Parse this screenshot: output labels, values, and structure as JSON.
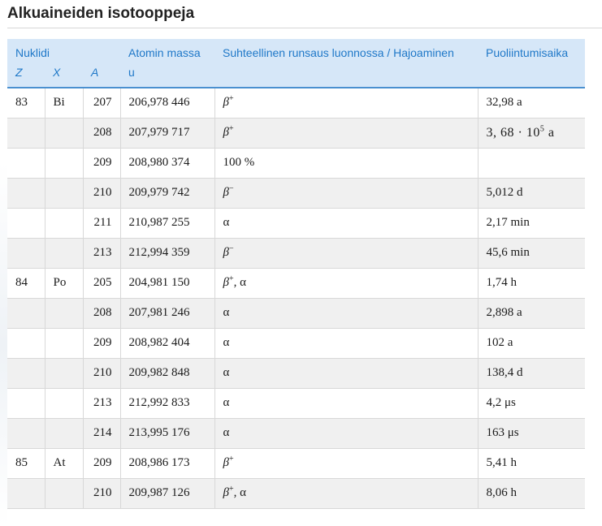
{
  "page": {
    "title": "Alkuaineiden isotooppeja"
  },
  "header": {
    "nuklidi": "Nuklidi",
    "z": "Z",
    "x": "X",
    "a": "A",
    "mass": "Atomin massa",
    "mass_unit": "u",
    "decay": "Suhteellinen runsaus luonnossa / Hajoaminen",
    "halflife": "Puoliintumisaika"
  },
  "rows": [
    {
      "z": "83",
      "x": "Bi",
      "a": "207",
      "mass": "206,978 446",
      "decay": "β+",
      "halflife": "32,98 a"
    },
    {
      "z": "",
      "x": "",
      "a": "208",
      "mass": "207,979 717",
      "decay": "β+",
      "halflife": "3, 68 · 105 a"
    },
    {
      "z": "",
      "x": "",
      "a": "209",
      "mass": "208,980 374",
      "decay": "100 %",
      "halflife": ""
    },
    {
      "z": "",
      "x": "",
      "a": "210",
      "mass": "209,979 742",
      "decay": "β−",
      "halflife": "5,012 d"
    },
    {
      "z": "",
      "x": "",
      "a": "211",
      "mass": "210,987 255",
      "decay": "α",
      "halflife": "2,17 min"
    },
    {
      "z": "",
      "x": "",
      "a": "213",
      "mass": "212,994 359",
      "decay": "β−",
      "halflife": "45,6 min"
    },
    {
      "z": "84",
      "x": "Po",
      "a": "205",
      "mass": "204,981 150",
      "decay": "β+, α",
      "halflife": "1,74 h"
    },
    {
      "z": "",
      "x": "",
      "a": "208",
      "mass": "207,981 246",
      "decay": "α",
      "halflife": "2,898 a"
    },
    {
      "z": "",
      "x": "",
      "a": "209",
      "mass": "208,982 404",
      "decay": "α",
      "halflife": "102 a"
    },
    {
      "z": "",
      "x": "",
      "a": "210",
      "mass": "209,982 848",
      "decay": "α",
      "halflife": "138,4 d"
    },
    {
      "z": "",
      "x": "",
      "a": "213",
      "mass": "212,992 833",
      "decay": "α",
      "halflife": "4,2 μs"
    },
    {
      "z": "",
      "x": "",
      "a": "214",
      "mass": "213,995 176",
      "decay": "α",
      "halflife": "163 μs"
    },
    {
      "z": "85",
      "x": "At",
      "a": "209",
      "mass": "208,986 173",
      "decay": "β+",
      "halflife": "5,41 h"
    },
    {
      "z": "",
      "x": "",
      "a": "210",
      "mass": "209,987 126",
      "decay": "β+, α",
      "halflife": "8,06 h"
    }
  ],
  "colors": {
    "header_bg": "#d6e7f8",
    "header_text": "#1f78c8",
    "alt_row": "#f0f0f0"
  }
}
